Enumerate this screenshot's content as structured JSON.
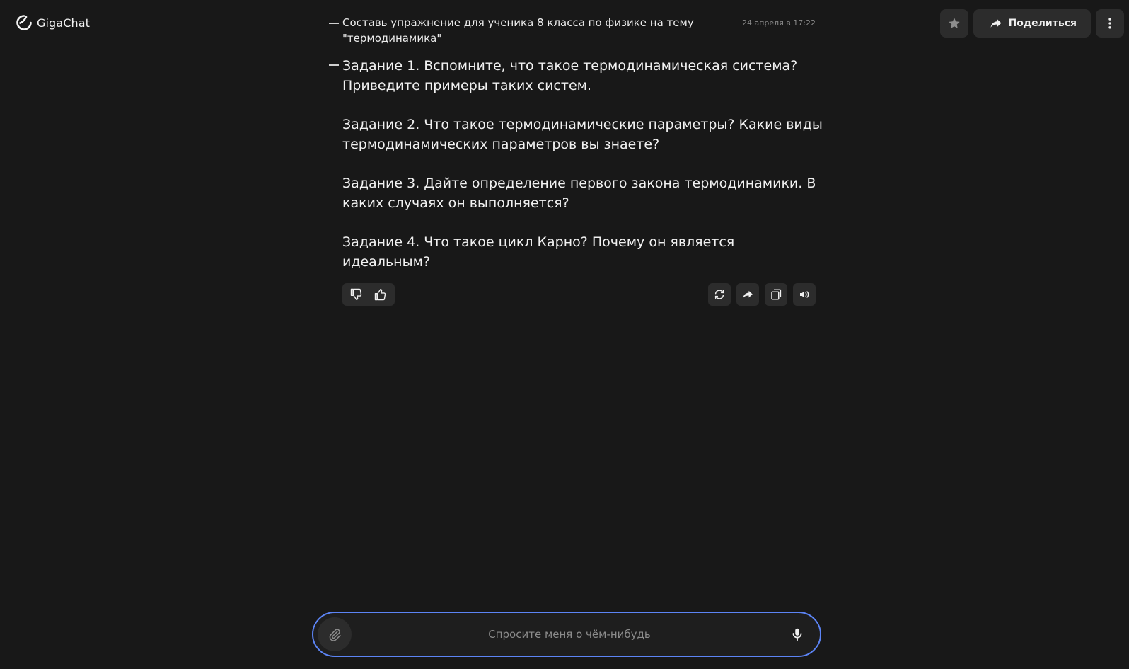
{
  "header": {
    "app_name": "GigaChat",
    "share_label": "Поделиться"
  },
  "conversation": {
    "user_message": "Составь упражнение для ученика 8 класса по физике на тему \"термодинамика\"",
    "timestamp": "24 апреля в 17:22",
    "bot_paragraphs": [
      "Задание 1. Вспомните, что такое термодинамическая система? Приведите примеры таких систем.",
      "Задание 2. Что такое термодинамические параметры? Какие виды термодинамических параметров вы знаете?",
      "Задание 3. Дайте определение первого закона термодинамики. В каких случаях он выполняется?",
      "Задание 4. Что такое цикл Карно? Почему он является идеальным?"
    ]
  },
  "composer": {
    "placeholder": "Спросите меня о чём-нибудь",
    "value": ""
  },
  "icons": {
    "logo": "gigachat-logo",
    "favorite": "star-icon",
    "share": "share-arrow-icon",
    "menu": "more-vertical-icon",
    "dislike": "thumbs-down-icon",
    "like": "thumbs-up-icon",
    "regenerate": "refresh-icon",
    "forward": "share-arrow-icon",
    "copy": "copy-icon",
    "speak": "speaker-icon",
    "attach": "paperclip-icon",
    "mic": "microphone-icon"
  },
  "colors": {
    "background": "#181818",
    "button": "#2c2c2c",
    "input_border": "#5c84f5"
  }
}
